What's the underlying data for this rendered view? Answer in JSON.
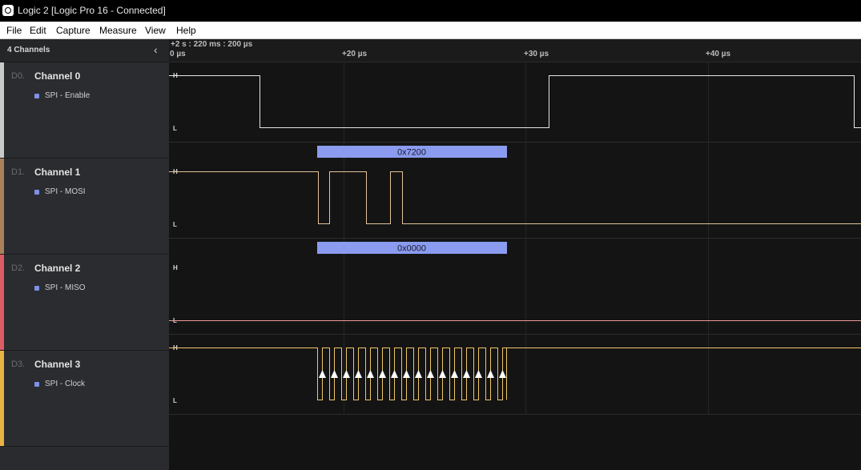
{
  "window": {
    "title": "Logic 2 [Logic Pro 16 - Connected]",
    "icon": "logic-app-icon"
  },
  "menu": [
    {
      "label": "File"
    },
    {
      "label": "Edit"
    },
    {
      "label": "Capture"
    },
    {
      "label": "Measure"
    },
    {
      "label": "View"
    },
    {
      "label": "Help"
    }
  ],
  "sidebar": {
    "channel_count": "4 Channels",
    "collapse_icon": "chevron-left-icon"
  },
  "channels": [
    {
      "index": "D0.",
      "name": "Channel 0",
      "analyzer": "SPI - Enable",
      "color": "#c9c9c9",
      "wave_color": "#e6e6e6"
    },
    {
      "index": "D1.",
      "name": "Channel 1",
      "analyzer": "SPI - MOSI",
      "color": "#a9825b",
      "wave_color": "#e2c39a"
    },
    {
      "index": "D2.",
      "name": "Channel 2",
      "analyzer": "SPI - MISO",
      "color": "#dc5c66",
      "wave_color": "#e89a9a"
    },
    {
      "index": "D3.",
      "name": "Channel 3",
      "analyzer": "SPI - Clock",
      "color": "#e7b343",
      "wave_color": "#efc66a"
    }
  ],
  "levels": {
    "high": "H",
    "low": "L"
  },
  "timeline": {
    "offset": "+2 s : 220 ms : 200 µs",
    "ticks": [
      "0 µs",
      "+20 µs",
      "+30 µs",
      "+40 µs"
    ]
  },
  "decodes": {
    "mosi": "0x7200",
    "miso": "0x0000"
  },
  "colors": {
    "annotation_bar": "#8b9bf0",
    "clock_arrow": "#ffffff"
  }
}
